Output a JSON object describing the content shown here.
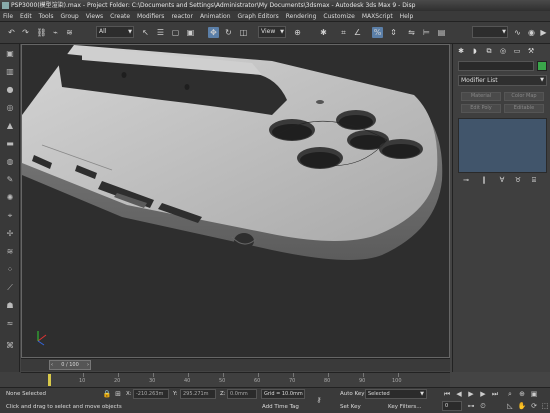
{
  "window": {
    "title": "PSP3000(模型渲染).max - Project Folder: C:\\Documents and Settings\\Administrator\\My Documents\\3dsmax - Autodesk 3ds Max 9 - Disp"
  },
  "menu": {
    "items": [
      "File",
      "Edit",
      "Tools",
      "Group",
      "Views",
      "Create",
      "Modifiers",
      "reactor",
      "Animation",
      "Graph Editors",
      "Rendering",
      "Customize",
      "MAXScript",
      "Help"
    ]
  },
  "toolbar": {
    "selection_filter": "All",
    "coord_system": "View"
  },
  "command_panel": {
    "modifier_list": "Modifier List",
    "buttons": [
      "Material",
      "Color Map",
      "Edit Poly",
      "Editable"
    ]
  },
  "time_slider": {
    "frame": "0 / 100"
  },
  "track_bar": {
    "ticks": [
      "10",
      "20",
      "30",
      "40",
      "50",
      "60",
      "70",
      "80",
      "90",
      "100"
    ]
  },
  "status": {
    "selection": "None Selected",
    "prompt": "Click and drag to select and move objects",
    "x_label": "X:",
    "x_value": "-210.263m",
    "y_label": "Y:",
    "y_value": "295.271m",
    "z_label": "Z:",
    "z_value": "0.0mm",
    "grid": "Grid = 10.0mm",
    "add_time_tag": "Add Time Tag",
    "auto_key": "Auto Key",
    "set_key": "Set Key",
    "key_mode": "Selected",
    "key_filters": "Key Filters...",
    "current_frame": "0"
  },
  "colors": {
    "viewport_bg": "#2e2e2e",
    "model_surface": "#b9b9b9",
    "stack_view": "#41556b",
    "object_color": "#3aa64a"
  }
}
